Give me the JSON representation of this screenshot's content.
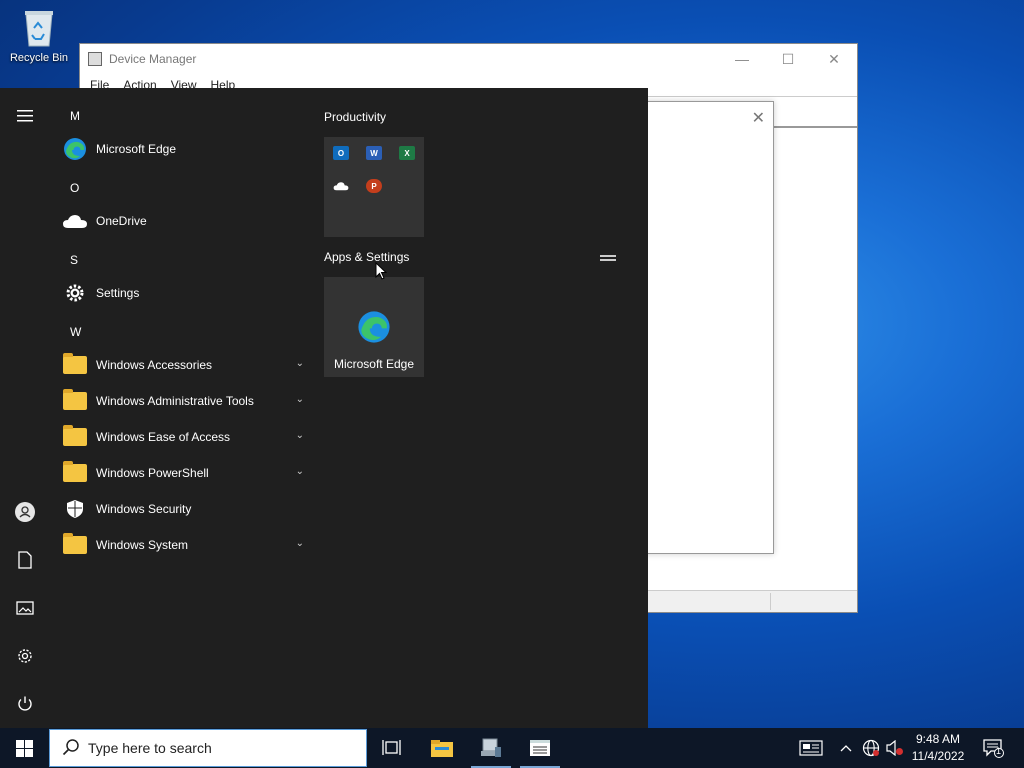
{
  "desktop": {
    "recycle_bin_label": "Recycle Bin"
  },
  "device_manager": {
    "title": "Device Manager",
    "menu": [
      "File",
      "Action",
      "View",
      "Help"
    ]
  },
  "start_menu": {
    "letters": [
      "M",
      "O",
      "S",
      "W"
    ],
    "apps": {
      "microsoft_edge": "Microsoft Edge",
      "onedrive": "OneDrive",
      "settings": "Settings",
      "windows_accessories": "Windows Accessories",
      "windows_admin_tools": "Windows Administrative Tools",
      "windows_ease_of_access": "Windows Ease of Access",
      "windows_powershell": "Windows PowerShell",
      "windows_security": "Windows Security",
      "windows_system": "Windows System"
    },
    "groups": {
      "productivity": "Productivity",
      "apps_settings": "Apps & Settings"
    },
    "tiles": {
      "edge_label": "Microsoft Edge",
      "outlook": "O",
      "word": "W",
      "excel": "X",
      "powerpoint": "P"
    }
  },
  "taskbar": {
    "search_placeholder": "Type here to search",
    "time": "9:48 AM",
    "date": "11/4/2022",
    "notification_count": "1"
  },
  "colors": {
    "start_bg": "#1f1f1f",
    "taskbar_bg": "#0d1727",
    "folder": "#f4c542",
    "edge_blue": "#1b8fe0",
    "edge_green": "#3cc36a"
  }
}
